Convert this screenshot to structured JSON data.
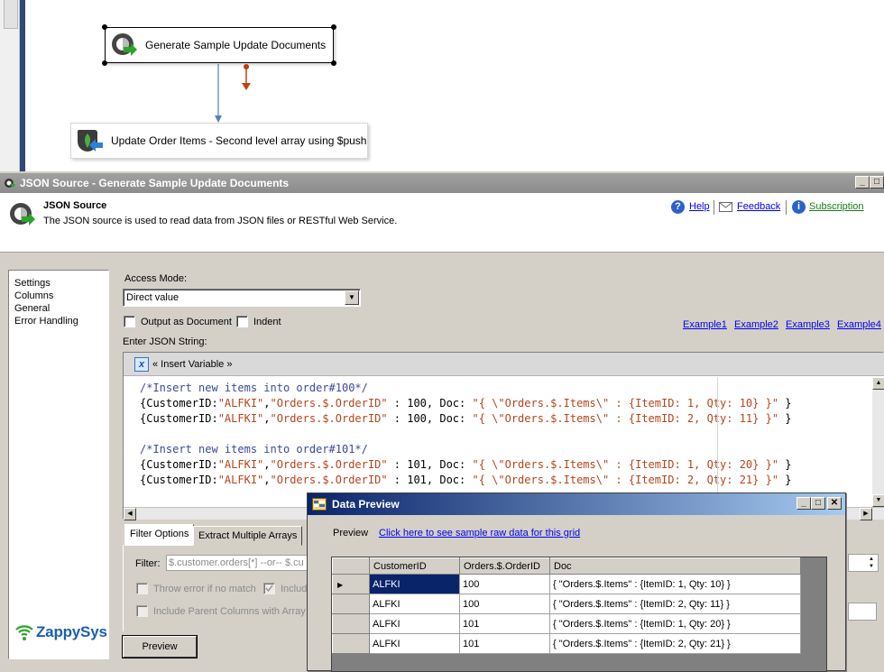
{
  "design_surface": {
    "task1_label": "Generate Sample Update Documents",
    "task2_label": "Update Order Items - Second level array using $push"
  },
  "dialog": {
    "title": "JSON Source - Generate Sample Update Documents",
    "header_title": "JSON Source",
    "header_desc": "The JSON source is used to read data from JSON files or RESTful Web Service.",
    "help_label": "Help",
    "feedback_label": "Feedback",
    "subscription_label": "Subscription"
  },
  "nav": {
    "items": [
      "Settings",
      "Columns",
      "General",
      "Error Handling"
    ]
  },
  "logo_text": "ZappySys",
  "form": {
    "access_mode_label": "Access Mode:",
    "access_mode_value": "Direct value",
    "output_as_document_label": "Output as Document",
    "indent_label": "Indent",
    "examples": [
      "Example1",
      "Example2",
      "Example3",
      "Example4"
    ],
    "json_label": "Enter JSON String:",
    "insert_variable_label": "« Insert Variable »",
    "code_lines": [
      [
        {
          "t": "/*Insert new items into order#100*/",
          "k": "c-comment"
        }
      ],
      [
        {
          "t": "{CustomerID:",
          "k": "c-plain"
        },
        {
          "t": "\"ALFKI\"",
          "k": "c-str"
        },
        {
          "t": ",",
          "k": "c-plain"
        },
        {
          "t": "\"Orders.$.OrderID\"",
          "k": "c-str"
        },
        {
          "t": " : 100, Doc: ",
          "k": "c-plain"
        },
        {
          "t": "\"{ \\\"Orders.$.Items\\\" : {ItemID: 1, Qty: 10} }\"",
          "k": "c-str"
        },
        {
          "t": " }",
          "k": "c-plain"
        }
      ],
      [
        {
          "t": "{CustomerID:",
          "k": "c-plain"
        },
        {
          "t": "\"ALFKI\"",
          "k": "c-str"
        },
        {
          "t": ",",
          "k": "c-plain"
        },
        {
          "t": "\"Orders.$.OrderID\"",
          "k": "c-str"
        },
        {
          "t": " : 100, Doc: ",
          "k": "c-plain"
        },
        {
          "t": "\"{ \\\"Orders.$.Items\\\" : {ItemID: 2, Qty: 11} }\"",
          "k": "c-str"
        },
        {
          "t": " }",
          "k": "c-plain"
        }
      ],
      [],
      [
        {
          "t": "/*Insert new items into order#101*/",
          "k": "c-comment"
        }
      ],
      [
        {
          "t": "{CustomerID:",
          "k": "c-plain"
        },
        {
          "t": "\"ALFKI\"",
          "k": "c-str"
        },
        {
          "t": ",",
          "k": "c-plain"
        },
        {
          "t": "\"Orders.$.OrderID\"",
          "k": "c-str"
        },
        {
          "t": " : 101, Doc: ",
          "k": "c-plain"
        },
        {
          "t": "\"{ \\\"Orders.$.Items\\\" : {ItemID: 1, Qty: 20} }\"",
          "k": "c-str"
        },
        {
          "t": " }",
          "k": "c-plain"
        }
      ],
      [
        {
          "t": "{CustomerID:",
          "k": "c-plain"
        },
        {
          "t": "\"ALFKI\"",
          "k": "c-str"
        },
        {
          "t": ",",
          "k": "c-plain"
        },
        {
          "t": "\"Orders.$.OrderID\"",
          "k": "c-str"
        },
        {
          "t": " : 101, Doc: ",
          "k": "c-plain"
        },
        {
          "t": "\"{ \\\"Orders.$.Items\\\" : {ItemID: 2, Qty: 21} }\"",
          "k": "c-str"
        },
        {
          "t": " }",
          "k": "c-plain"
        }
      ]
    ],
    "tabs": [
      "Filter Options",
      "Extract Multiple Arrays"
    ],
    "filter_label": "Filter:",
    "filter_placeholder": "$.customer.orders[*] --or-- $.cu",
    "throw_error_label": "Throw error if no match",
    "include_label": "Includ",
    "include_parent_label": "Include Parent Columns with Array",
    "preview_button": "Preview"
  },
  "preview_window": {
    "title": "Data Preview",
    "preview_label": "Preview",
    "raw_link": "Click here to see sample raw data for this grid",
    "columns": [
      "CustomerID",
      "Orders.$.OrderID",
      "Doc"
    ],
    "rows": [
      [
        "ALFKI",
        "100",
        "{ \"Orders.$.Items\" : {ItemID: 1, Qty: 10} }"
      ],
      [
        "ALFKI",
        "100",
        "{ \"Orders.$.Items\" : {ItemID: 2, Qty: 11} }"
      ],
      [
        "ALFKI",
        "101",
        "{ \"Orders.$.Items\" : {ItemID: 1, Qty: 20} }"
      ],
      [
        "ALFKI",
        "101",
        "{ \"Orders.$.Items\" : {ItemID: 2, Qty: 21} }"
      ]
    ]
  },
  "colors": {
    "title_active": "#0a246a",
    "title_inactive": "#8c8c8c",
    "link": "#0000ee",
    "code_string": "#b5451b",
    "code_comment": "#3a4a9a"
  }
}
